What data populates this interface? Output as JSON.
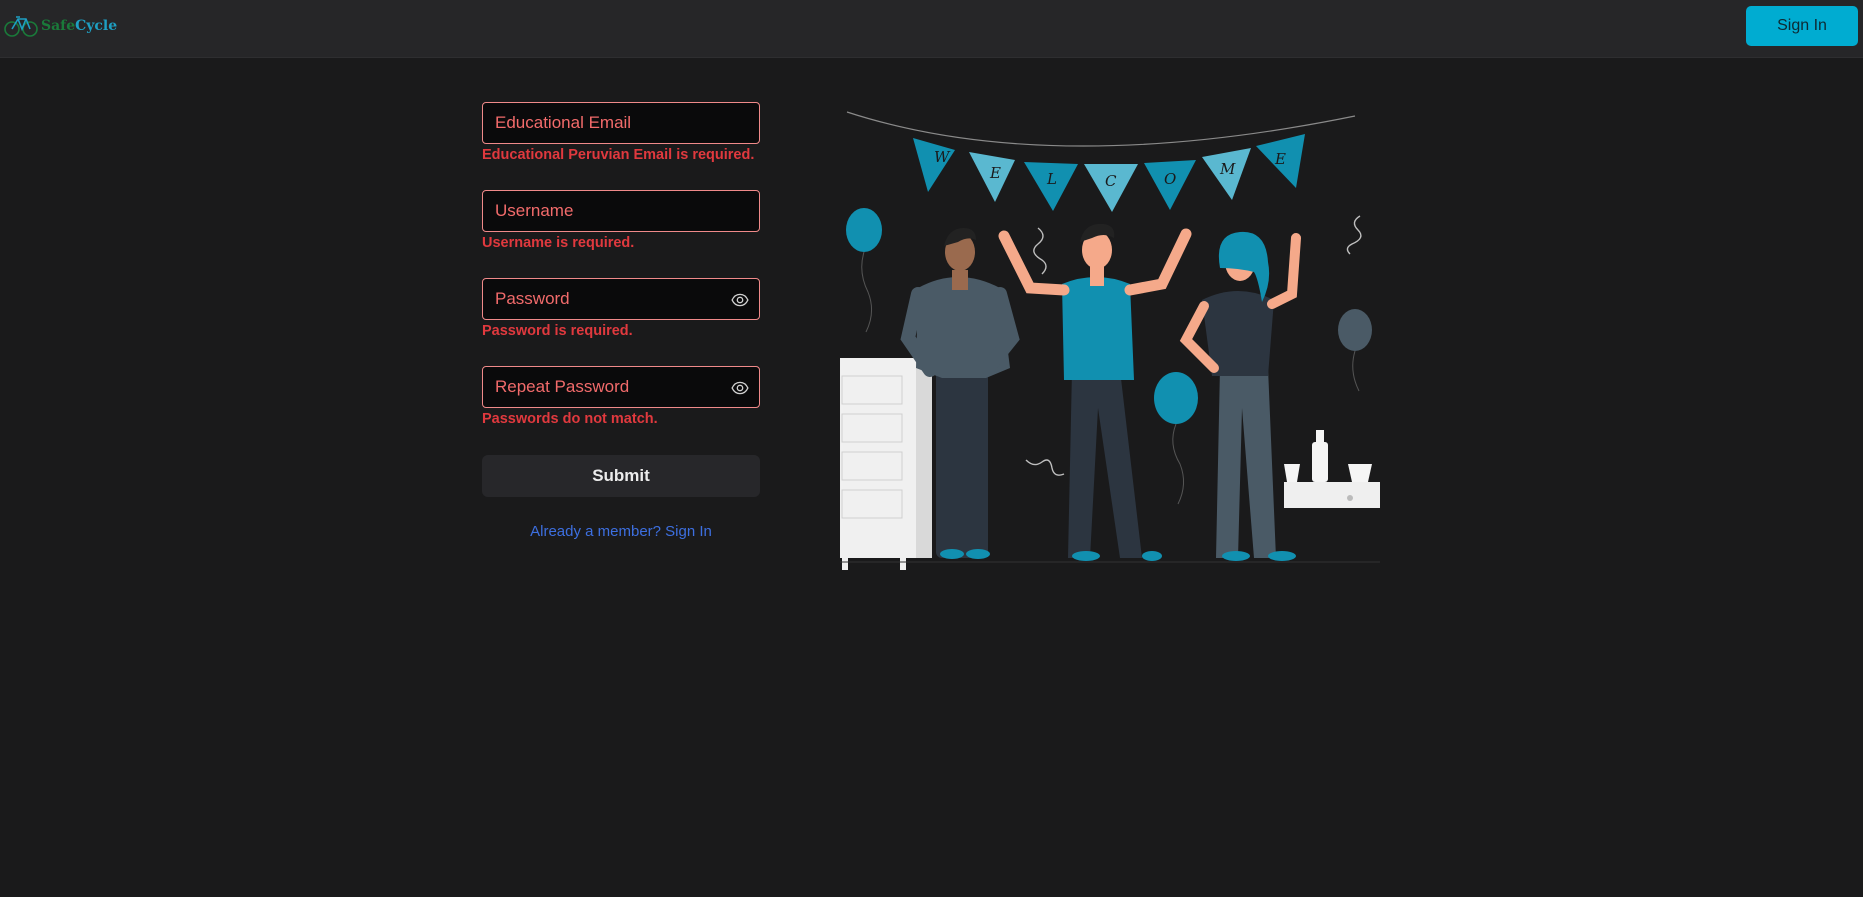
{
  "navbar": {
    "logo": {
      "text_part1": "Safe",
      "text_part2": "Cycle",
      "icon": "bicycle-icon",
      "color1": "#1a7a3a",
      "color2": "#1e9fc2"
    },
    "signin_label": "Sign In",
    "signin_color": "#00acd1"
  },
  "form": {
    "email": {
      "placeholder": "Educational Email",
      "value": "",
      "error": "Educational Peruvian Email is required."
    },
    "username": {
      "placeholder": "Username",
      "value": "",
      "error": "Username is required."
    },
    "password": {
      "placeholder": "Password",
      "value": "",
      "error": "Password is required.",
      "toggle_icon": "eye-icon"
    },
    "repeat_password": {
      "placeholder": "Repeat Password",
      "value": "",
      "error": "Passwords do not match.",
      "toggle_icon": "eye-icon"
    },
    "submit_label": "Submit",
    "member_link": "Already a member? Sign In",
    "error_color": "#e0393e",
    "link_color": "#3d6fe0"
  },
  "illustration": {
    "banner_letters": [
      "W",
      "E",
      "L",
      "C",
      "O",
      "M",
      "E"
    ],
    "accent_color": "#1190b0"
  }
}
